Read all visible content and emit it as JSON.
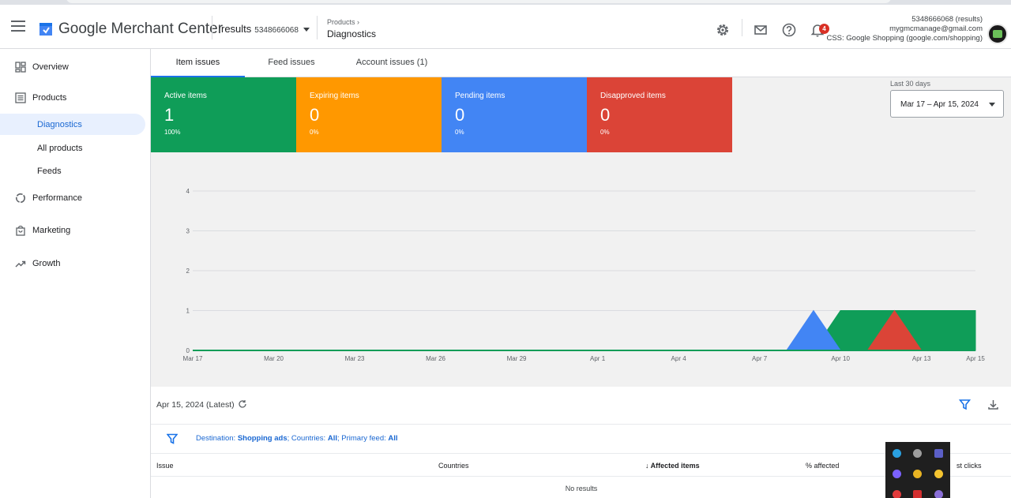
{
  "header": {
    "brand": "Google Merchant Center",
    "account_name": "results",
    "account_id": "5348666068",
    "breadcrumb_parent": "Products",
    "page_title": "Diagnostics",
    "notification_count": "4",
    "account_line1": "5348666068 (results)",
    "account_line2": "mygmcmanage@gmail.com",
    "account_line3": "CSS: Google Shopping (google.com/shopping)"
  },
  "sidebar": {
    "items": [
      {
        "label": "Overview",
        "icon": "dashboard-icon"
      },
      {
        "label": "Products",
        "icon": "list-icon"
      },
      {
        "label": "Diagnostics"
      },
      {
        "label": "All products"
      },
      {
        "label": "Feeds"
      },
      {
        "label": "Performance",
        "icon": "donut-icon"
      },
      {
        "label": "Marketing",
        "icon": "bag-icon"
      },
      {
        "label": "Growth",
        "icon": "trending-icon"
      }
    ]
  },
  "tabs": [
    {
      "label": "Item issues"
    },
    {
      "label": "Feed issues"
    },
    {
      "label": "Account issues (1)"
    }
  ],
  "stats": [
    {
      "label": "Active items",
      "value": "1",
      "pct": "100%",
      "color": "#0f9d58"
    },
    {
      "label": "Expiring items",
      "value": "0",
      "pct": "0%",
      "color": "#ff9800"
    },
    {
      "label": "Pending items",
      "value": "0",
      "pct": "0%",
      "color": "#4285f4"
    },
    {
      "label": "Disapproved items",
      "value": "0",
      "pct": "0%",
      "color": "#db4437"
    }
  ],
  "date_range": {
    "label": "Last 30 days",
    "value": "Mar 17 – Apr 15, 2024"
  },
  "chart_data": {
    "type": "area",
    "y_ticks": [
      "0",
      "1",
      "2",
      "3",
      "4"
    ],
    "ylim": [
      0,
      4
    ],
    "x_ticks": [
      "Mar 17",
      "Mar 20",
      "Mar 23",
      "Mar 26",
      "Mar 29",
      "Apr 1",
      "Apr 4",
      "Apr 7",
      "Apr 10",
      "Apr 13",
      "Apr 15"
    ],
    "x": [
      "Mar 17",
      "Apr 8",
      "Apr 9",
      "Apr 10",
      "Apr 11",
      "Apr 12",
      "Apr 13",
      "Apr 14",
      "Apr 15"
    ],
    "series": [
      {
        "name": "Active items",
        "color": "#0f9d58",
        "values": [
          0,
          0,
          0,
          1,
          1,
          1,
          1,
          1,
          1
        ]
      },
      {
        "name": "Pending items",
        "color": "#4285f4",
        "values": [
          0,
          0,
          1,
          0,
          0,
          0,
          0,
          0,
          0
        ]
      },
      {
        "name": "Disapproved items",
        "color": "#db4437",
        "values": [
          0,
          0,
          0,
          0,
          0,
          1,
          0,
          0,
          0
        ]
      }
    ],
    "grid": true,
    "legend": "none"
  },
  "report": {
    "date_label": "Apr 15, 2024 (Latest)",
    "filter_dest_label": "Destination: ",
    "filter_dest_value": "Shopping ads",
    "filter_countries_label": "; Countries: ",
    "filter_countries_value": "All",
    "filter_feed_label": "; Primary feed: ",
    "filter_feed_value": "All",
    "columns": [
      "Issue",
      "Countries",
      "Affected items",
      "% affected",
      "st clicks"
    ],
    "empty_text": "No results"
  }
}
